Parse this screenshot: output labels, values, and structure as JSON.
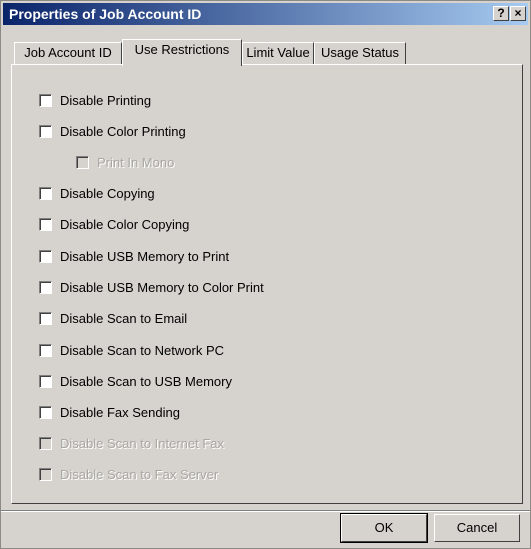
{
  "window": {
    "title": "Properties of Job Account ID",
    "help_label": "?",
    "close_label": "×"
  },
  "tabs": [
    {
      "label": "Job Account ID",
      "active": false
    },
    {
      "label": "Use Restrictions",
      "active": true
    },
    {
      "label": "Limit Value",
      "active": false
    },
    {
      "label": "Usage Status",
      "active": false
    }
  ],
  "options": [
    {
      "label": "Disable Printing",
      "checked": false,
      "enabled": true
    },
    {
      "label": "Disable Color Printing",
      "checked": false,
      "enabled": true
    },
    {
      "label": "Print In Mono",
      "checked": false,
      "enabled": false
    },
    {
      "label": "Disable Copying",
      "checked": false,
      "enabled": true
    },
    {
      "label": "Disable Color Copying",
      "checked": false,
      "enabled": true
    },
    {
      "label": "Disable USB Memory to Print",
      "checked": false,
      "enabled": true
    },
    {
      "label": "Disable USB Memory to Color Print",
      "checked": false,
      "enabled": true
    },
    {
      "label": "Disable Scan to Email",
      "checked": false,
      "enabled": true
    },
    {
      "label": "Disable Scan to Network PC",
      "checked": false,
      "enabled": true
    },
    {
      "label": "Disable Scan to USB Memory",
      "checked": false,
      "enabled": true
    },
    {
      "label": "Disable Fax Sending",
      "checked": false,
      "enabled": true
    },
    {
      "label": "Disable Scan to Internet Fax",
      "checked": false,
      "enabled": false
    },
    {
      "label": "Disable Scan to Fax Server",
      "checked": false,
      "enabled": false
    }
  ],
  "buttons": {
    "ok_label": "OK",
    "cancel_label": "Cancel"
  }
}
